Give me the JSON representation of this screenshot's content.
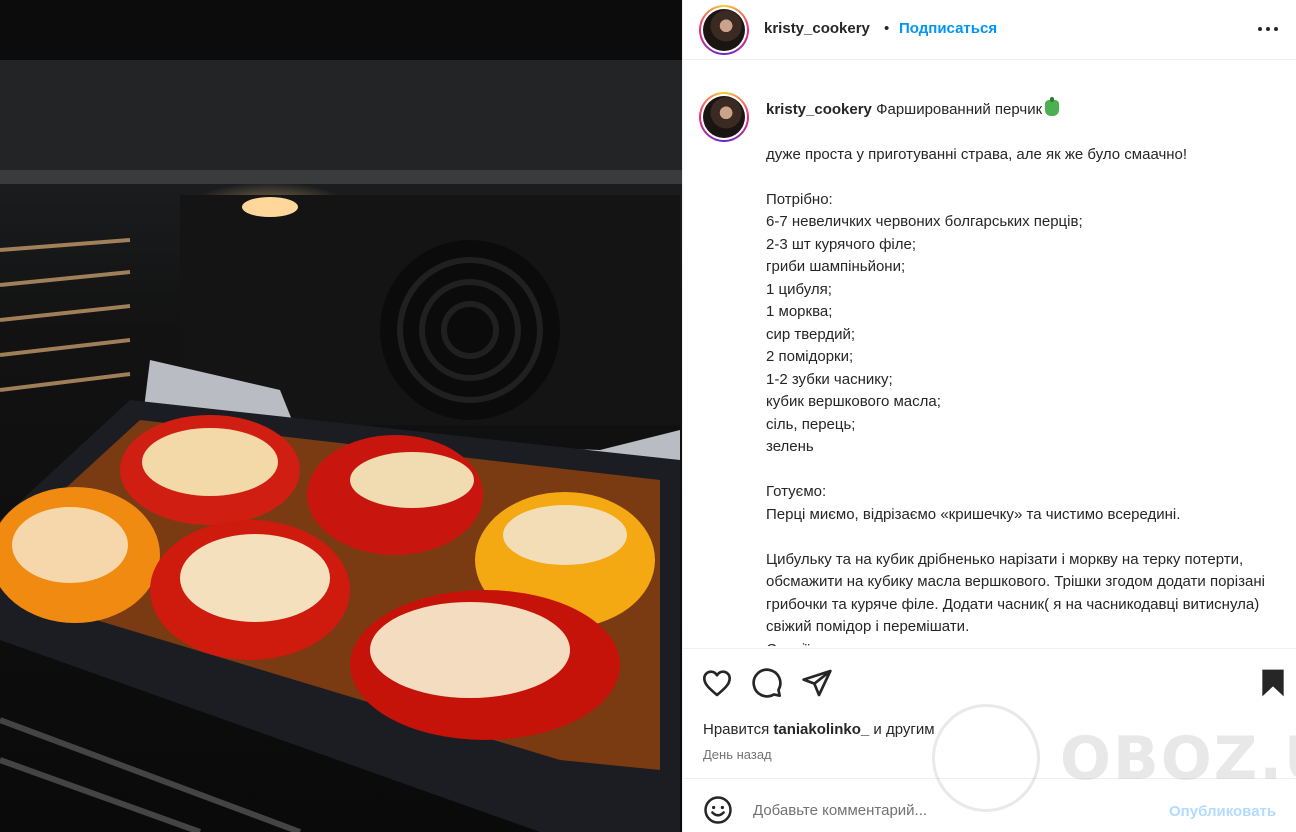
{
  "post": {
    "username": "kristy_cookery",
    "separator": "•",
    "follow_label": "Подписаться",
    "caption_title": "Фаршированний перчик",
    "caption_lines": [
      "дуже проста у приготуванні страва, але як же було смаачно!",
      "",
      "Потрібно:",
      "6-7 невеличких червоних болгарських перців;",
      "2-3 шт курячого філе;",
      "гриби шампіньйони;",
      "1 цибуля;",
      "1 морква;",
      "сир твердий;",
      "2 помідорки;",
      "1-2 зубки часнику;",
      "кубик вершкового масла;",
      "сіль, перець;",
      "зелень",
      "",
      "Готуємо:",
      "Перці миємо, відрізаємо «кришечку» та чистимо всередині.",
      "",
      "Цибульку та на кубик дрібненько нарізати і моркву на терку потерти, обсмажити на кубику масла вершкового. Трішки згодом додати порізані грибочки та куряче філе. Додати часник( я на часникодавці витиснула) свіжий помідор і перемішати.",
      "Спеції по смаку."
    ],
    "likes_prefix": "Нравится",
    "likes_user": "taniakolinko_",
    "likes_suffix": "и другим",
    "timestamp": "День назад"
  },
  "comment": {
    "placeholder": "Добавьте комментарий...",
    "publish_label": "Опубликовать"
  },
  "watermark": {
    "text": "OBOZ.UA"
  },
  "icons": [
    "more-icon",
    "heart-icon",
    "comment-icon",
    "share-icon",
    "bookmark-icon",
    "emoji-icon"
  ],
  "colors": {
    "link": "#0095f6",
    "publish_disabled": "#b3dbff",
    "secondary_text": "#737373"
  }
}
